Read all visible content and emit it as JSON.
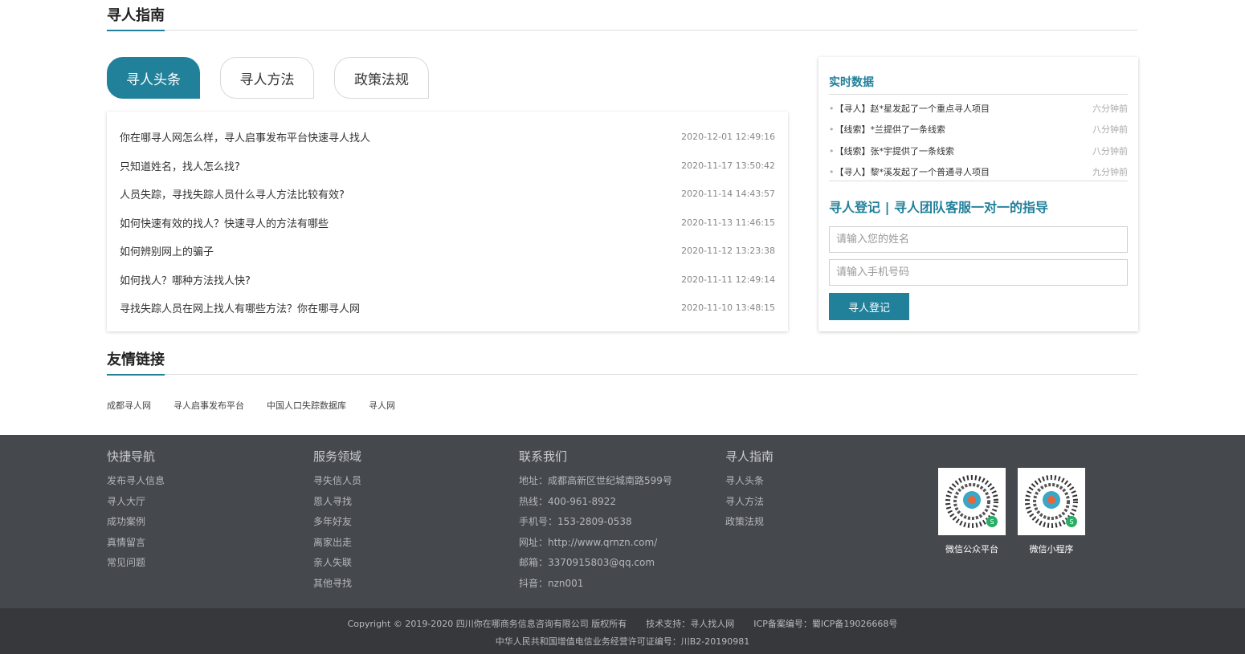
{
  "guide": {
    "title": "寻人指南"
  },
  "tabs": [
    {
      "label": "寻人头条",
      "active": true
    },
    {
      "label": "寻人方法",
      "active": false
    },
    {
      "label": "政策法规",
      "active": false
    }
  ],
  "news": [
    {
      "title": "你在哪寻人网怎么样，寻人启事发布平台快速寻人找人",
      "date": "2020-12-01 12:49:16"
    },
    {
      "title": "只知道姓名，找人怎么找?",
      "date": "2020-11-17 13:50:42"
    },
    {
      "title": "人员失踪，寻找失踪人员什么寻人方法比较有效?",
      "date": "2020-11-14 14:43:57"
    },
    {
      "title": "如何快速有效的找人？快速寻人的方法有哪些",
      "date": "2020-11-13 11:46:15"
    },
    {
      "title": "如何辨别网上的骗子",
      "date": "2020-11-12 13:23:38"
    },
    {
      "title": "如何找人？哪种方法找人快?",
      "date": "2020-11-11 12:49:14"
    },
    {
      "title": "寻找失踪人员在网上找人有哪些方法？你在哪寻人网",
      "date": "2020-11-10 13:48:15"
    }
  ],
  "realtime": {
    "title": "实时数据",
    "items": [
      {
        "text": "【寻人】赵*星发起了一个重点寻人项目",
        "time": "六分钟前"
      },
      {
        "text": "【线索】*兰提供了一条线索",
        "time": "八分钟前"
      },
      {
        "text": "【线索】张*宇提供了一条线索",
        "time": "八分钟前"
      },
      {
        "text": "【寻人】黎*溪发起了一个普通寻人项目",
        "time": "九分钟前"
      }
    ]
  },
  "register": {
    "title": "寻人登记 | 寻人团队客服一对一的指导",
    "name_placeholder": "请输入您的姓名",
    "phone_placeholder": "请输入手机号码",
    "button": "寻人登记"
  },
  "friends": {
    "title": "友情链接",
    "links": [
      "成都寻人网",
      "寻人启事发布平台",
      "中国人口失踪数据库",
      "寻人网"
    ]
  },
  "footer": {
    "cols": [
      {
        "heading": "快捷导航",
        "items": [
          "发布寻人信息",
          "寻人大厅",
          "成功案例",
          "真情留言",
          "常见问题"
        ]
      },
      {
        "heading": "服务领域",
        "items": [
          "寻失信人员",
          "恩人寻找",
          "多年好友",
          "离家出走",
          "亲人失联",
          "其他寻找"
        ]
      },
      {
        "heading": "联系我们",
        "items": [
          "地址：成都高新区世纪城南路599号",
          "热线：400-961-8922",
          "手机号：153-2809-0538",
          "网址：http://www.qrnzn.com/",
          "邮箱：3370915803@qq.com",
          "抖音：nzn001"
        ]
      },
      {
        "heading": "寻人指南",
        "items": [
          "寻人头条",
          "寻人方法",
          "政策法规"
        ]
      }
    ],
    "qr": [
      {
        "label": "微信公众平台"
      },
      {
        "label": "微信小程序"
      }
    ],
    "copyright": "Copyright © 2019-2020 四川你在哪商务信息咨询有限公司 版权所有",
    "tech": "技术支持：寻人找人网",
    "icp": "ICP备案编号：蜀ICP备19026668号",
    "license": "中华人民共和国增值电信业务经营许可证编号：川B2-20190981"
  },
  "colors": {
    "accent": "#21809a",
    "footer_bg": "#45484d",
    "footer_bottom_bg": "#36383c"
  }
}
